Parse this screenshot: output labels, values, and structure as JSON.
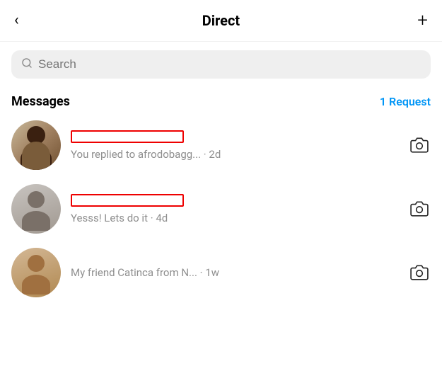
{
  "header": {
    "back_label": "‹",
    "title": "Direct",
    "plus_label": "+"
  },
  "search": {
    "placeholder": "Search",
    "icon": "🔍"
  },
  "messages_section": {
    "label": "Messages",
    "request_label": "1 Request"
  },
  "messages": [
    {
      "id": 1,
      "preview": "You replied to afrodobagg... · 2d",
      "has_red_box": true,
      "avatar_style": "avatar-1"
    },
    {
      "id": 2,
      "preview": "Yesss! Lets do it · 4d",
      "has_red_box": true,
      "avatar_style": "avatar-2"
    },
    {
      "id": 3,
      "preview": "My friend Catinca from N... · 1w",
      "has_red_box": false,
      "avatar_style": "avatar-3"
    }
  ],
  "icons": {
    "camera": "camera-icon",
    "search": "search-icon",
    "back": "back-icon",
    "plus": "plus-icon"
  }
}
